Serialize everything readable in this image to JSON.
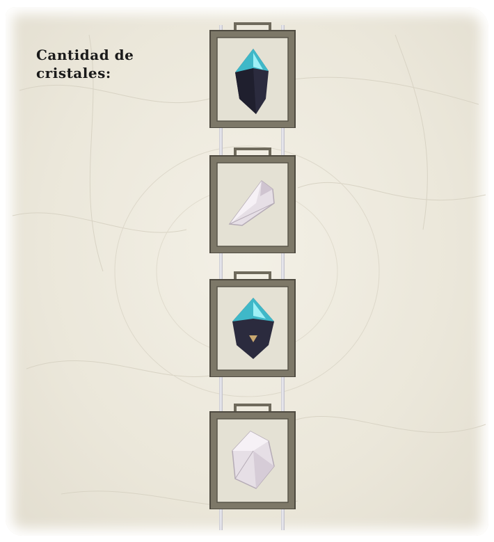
{
  "panel": {
    "title": "Cantidad de cristales:"
  },
  "crystals": [
    {
      "kind": "dark-teal-crystal",
      "color": "#2a2a3c",
      "accent": "#3fb8c8"
    },
    {
      "kind": "white-quartz-crystal",
      "color": "#e6dfe6",
      "accent": "#b5abb6"
    },
    {
      "kind": "dark-teal-crystal",
      "color": "#2a2a3c",
      "accent": "#3fb8c8"
    },
    {
      "kind": "white-quartz-crystal",
      "color": "#e6dfe6",
      "accent": "#b5abb6"
    }
  ],
  "colors": {
    "frame": "#7d7868",
    "frame_inner": "#e4e1d4",
    "parchment": "#ece8dc",
    "text": "#1a1a1a"
  }
}
